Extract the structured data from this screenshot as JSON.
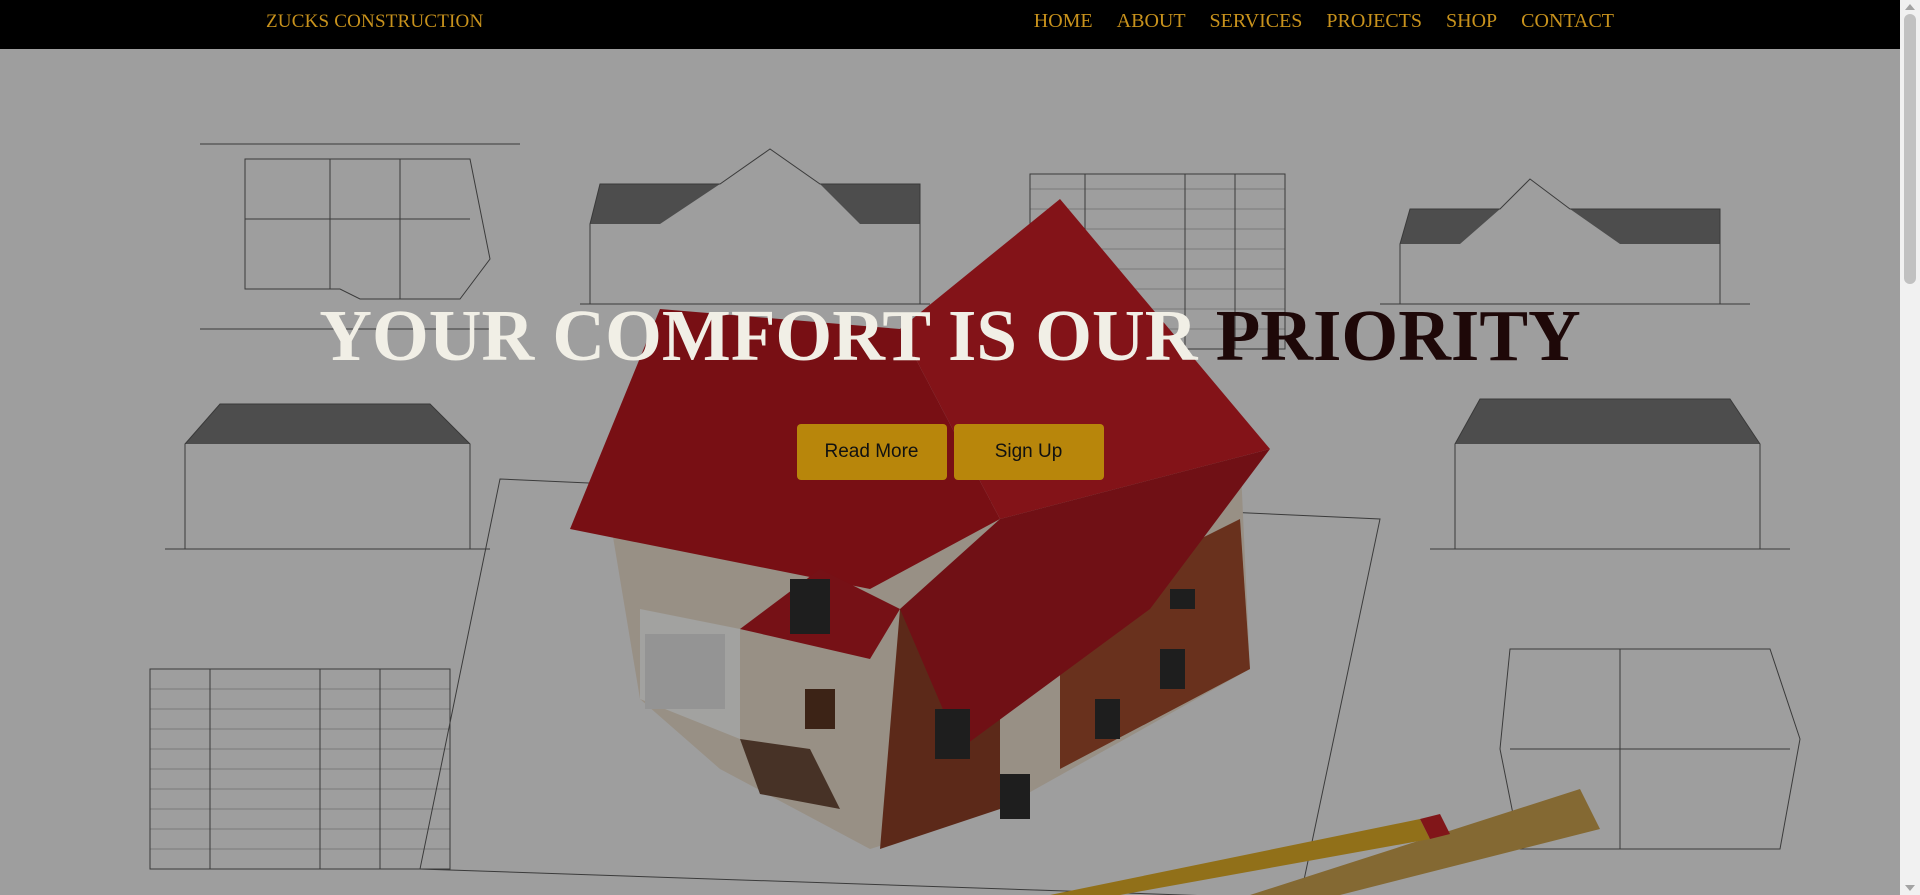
{
  "brand": "ZUCKS CONSTRUCTION",
  "nav": {
    "items": [
      "HOME",
      "ABOUT",
      "SERVICES",
      "PROJECTS",
      "SHOP",
      "CONTACT"
    ]
  },
  "hero": {
    "headline_light": "YOUR COMFORT IS OUR ",
    "headline_dark": "PRIORITY",
    "read_more": "Read More",
    "sign_up": "Sign Up"
  },
  "colors": {
    "nav_bg": "#000000",
    "accent": "#c8921c",
    "button": "#b8860b",
    "headline_light": "#f1efe6",
    "headline_dark": "#1e0808"
  }
}
